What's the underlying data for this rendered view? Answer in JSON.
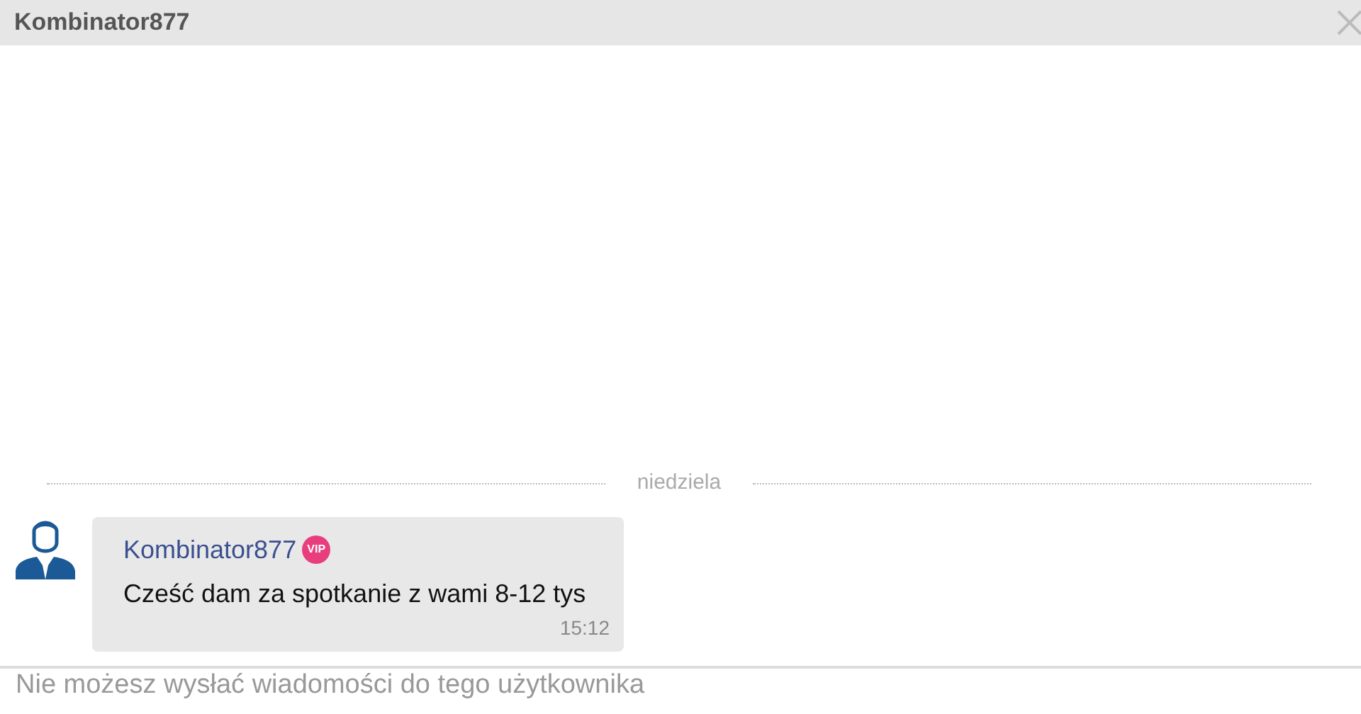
{
  "header": {
    "title": "Kombinator877"
  },
  "date_divider": "niedziela",
  "messages": [
    {
      "sender": "Kombinator877",
      "badge": "VIP",
      "text": "Cześć dam za spotkanie z wami 8-12 tys",
      "time": "15:12"
    }
  ],
  "footer": {
    "notice": "Nie możesz wysłać wiadomości do tego użytkownika"
  }
}
